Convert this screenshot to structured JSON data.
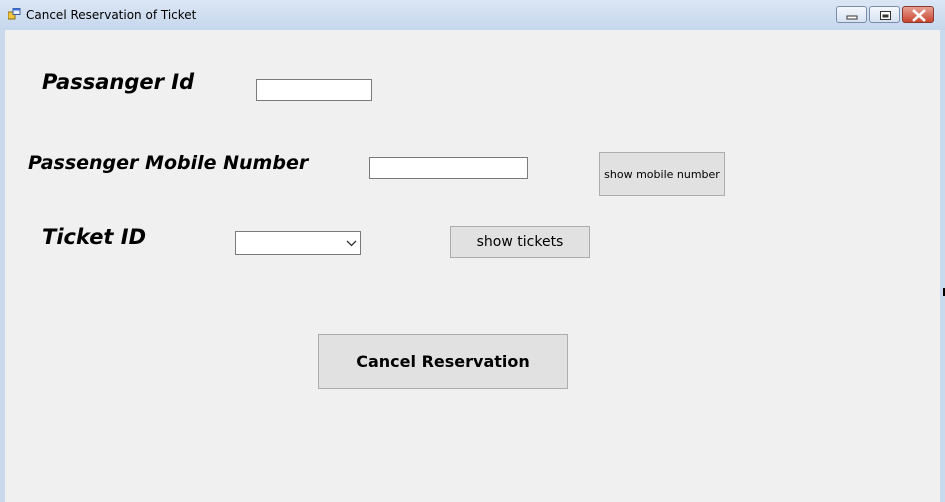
{
  "window": {
    "title": "Cancel Reservation of Ticket",
    "controls": {
      "minimize": "minimize-icon",
      "maximize": "restore-icon",
      "close": "close-icon"
    }
  },
  "form": {
    "passenger_id": {
      "label": "Passanger Id",
      "value": "",
      "placeholder": ""
    },
    "mobile_number": {
      "label": "Passenger Mobile Number",
      "value": "",
      "placeholder": ""
    },
    "ticket_id": {
      "label": "Ticket ID",
      "selected": ""
    },
    "show_mobile_button": "show mobile number",
    "show_tickets_button": "show tickets",
    "cancel_button": "Cancel Reservation"
  },
  "colors": {
    "form_background": "#f0f0f0",
    "button_background": "#e1e1e1",
    "titlebar": "#c6d7ed",
    "close_button": "#c8452e"
  }
}
